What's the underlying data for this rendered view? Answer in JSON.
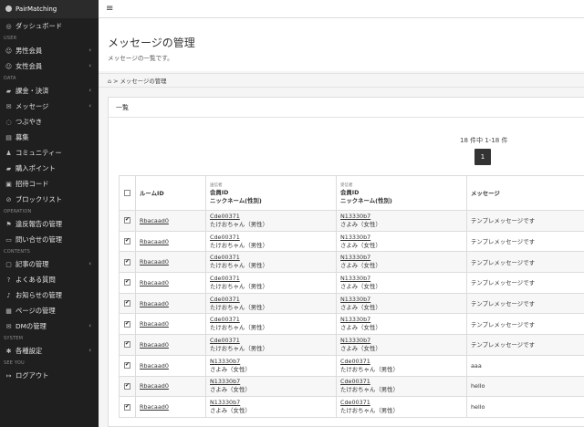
{
  "brand": "PairMatching",
  "sidebar": {
    "items": [
      {
        "type": "item",
        "icon": "dashboard-icon",
        "glyph": "◎",
        "label": "ダッシュボード",
        "chevron": false
      },
      {
        "type": "section",
        "label": "USER"
      },
      {
        "type": "item",
        "icon": "user-icon",
        "glyph": "☺",
        "label": "男性会員",
        "chevron": true
      },
      {
        "type": "item",
        "icon": "user-icon",
        "glyph": "☺",
        "label": "女性会員",
        "chevron": true
      },
      {
        "type": "section",
        "label": "DATA"
      },
      {
        "type": "item",
        "icon": "cart-icon",
        "glyph": "▰",
        "label": "課金・決済",
        "chevron": true
      },
      {
        "type": "item",
        "icon": "chat-icon",
        "glyph": "✉",
        "label": "メッセージ",
        "chevron": true
      },
      {
        "type": "item",
        "icon": "speech-icon",
        "glyph": "◌",
        "label": "つぶやき",
        "chevron": false
      },
      {
        "type": "item",
        "icon": "clipboard-icon",
        "glyph": "▤",
        "label": "募集",
        "chevron": false
      },
      {
        "type": "item",
        "icon": "group-icon",
        "glyph": "♟",
        "label": "コミュニティー",
        "chevron": false
      },
      {
        "type": "item",
        "icon": "cart-icon",
        "glyph": "▰",
        "label": "購入ポイント",
        "chevron": false
      },
      {
        "type": "item",
        "icon": "code-icon",
        "glyph": "▣",
        "label": "招待コード",
        "chevron": false
      },
      {
        "type": "item",
        "icon": "block-icon",
        "glyph": "⊘",
        "label": "ブロックリスト",
        "chevron": false
      },
      {
        "type": "section",
        "label": "OPERATION"
      },
      {
        "type": "item",
        "icon": "flag-icon",
        "glyph": "⚑",
        "label": "違反報告の管理",
        "chevron": false
      },
      {
        "type": "item",
        "icon": "inbox-icon",
        "glyph": "▭",
        "label": "問い合せの管理",
        "chevron": false
      },
      {
        "type": "section",
        "label": "CONTENTS"
      },
      {
        "type": "item",
        "icon": "article-icon",
        "glyph": "▢",
        "label": "記事の管理",
        "chevron": true
      },
      {
        "type": "item",
        "icon": "question-icon",
        "glyph": "?",
        "label": "よくある質問",
        "chevron": false
      },
      {
        "type": "item",
        "icon": "bell-icon",
        "glyph": "♪",
        "label": "お知らせの管理",
        "chevron": false
      },
      {
        "type": "item",
        "icon": "page-icon",
        "glyph": "▦",
        "label": "ページの管理",
        "chevron": false
      },
      {
        "type": "item",
        "icon": "mail-icon",
        "glyph": "✉",
        "label": "DMの管理",
        "chevron": true
      },
      {
        "type": "section",
        "label": "SYSTEM"
      },
      {
        "type": "item",
        "icon": "gear-icon",
        "glyph": "✱",
        "label": "各種設定",
        "chevron": true
      },
      {
        "type": "section",
        "label": "SEE YOU"
      },
      {
        "type": "item",
        "icon": "logout-icon",
        "glyph": "↦",
        "label": "ログアウト",
        "chevron": false
      }
    ]
  },
  "header": {
    "title": "メッセージの管理",
    "subtitle": "メッセージの一覧です。"
  },
  "breadcrumb": {
    "home_glyph": "⌂",
    "separator": ">",
    "current": "メッセージの管理"
  },
  "panel": {
    "title": "一覧",
    "count_text": "18 件中 1-18 件",
    "page": "1"
  },
  "table": {
    "headers": {
      "room": "ルームID",
      "sender_small": "送信者",
      "sender_line1": "会員ID",
      "sender_line2": "ニックネーム(性別)",
      "receiver_small": "受信者",
      "receiver_line1": "会員ID",
      "receiver_line2": "ニックネーム(性別)",
      "message": "メッセージ"
    },
    "rows": [
      {
        "room": "Rbacaad0",
        "s_id": "Cde00371",
        "s_name": "たけおちゃん（男性）",
        "r_id": "N13330b7",
        "r_name": "さよみ（女性）",
        "msg": "テンプレメッセージです"
      },
      {
        "room": "Rbacaad0",
        "s_id": "Cde00371",
        "s_name": "たけおちゃん（男性）",
        "r_id": "N13330b7",
        "r_name": "さよみ（女性）",
        "msg": "テンプレメッセージです"
      },
      {
        "room": "Rbacaad0",
        "s_id": "Cde00371",
        "s_name": "たけおちゃん（男性）",
        "r_id": "N13330b7",
        "r_name": "さよみ（女性）",
        "msg": "テンプレメッセージです"
      },
      {
        "room": "Rbacaad0",
        "s_id": "Cde00371",
        "s_name": "たけおちゃん（男性）",
        "r_id": "N13330b7",
        "r_name": "さよみ（女性）",
        "msg": "テンプレメッセージです"
      },
      {
        "room": "Rbacaad0",
        "s_id": "Cde00371",
        "s_name": "たけおちゃん（男性）",
        "r_id": "N13330b7",
        "r_name": "さよみ（女性）",
        "msg": "テンプレメッセージです"
      },
      {
        "room": "Rbacaad0",
        "s_id": "Cde00371",
        "s_name": "たけおちゃん（男性）",
        "r_id": "N13330b7",
        "r_name": "さよみ（女性）",
        "msg": "テンプレメッセージです"
      },
      {
        "room": "Rbacaad0",
        "s_id": "Cde00371",
        "s_name": "たけおちゃん（男性）",
        "r_id": "N13330b7",
        "r_name": "さよみ（女性）",
        "msg": "テンプレメッセージです"
      },
      {
        "room": "Rbacaad0",
        "s_id": "N13330b7",
        "s_name": "さよみ（女性）",
        "r_id": "Cde00371",
        "r_name": "たけおちゃん（男性）",
        "msg": "aaa"
      },
      {
        "room": "Rbacaad0",
        "s_id": "N13330b7",
        "s_name": "さよみ（女性）",
        "r_id": "Cde00371",
        "r_name": "たけおちゃん（男性）",
        "msg": "hello"
      },
      {
        "room": "Rbacaad0",
        "s_id": "N13330b7",
        "s_name": "さよみ（女性）",
        "r_id": "Cde00371",
        "r_name": "たけおちゃん（男性）",
        "msg": "hello"
      }
    ]
  }
}
